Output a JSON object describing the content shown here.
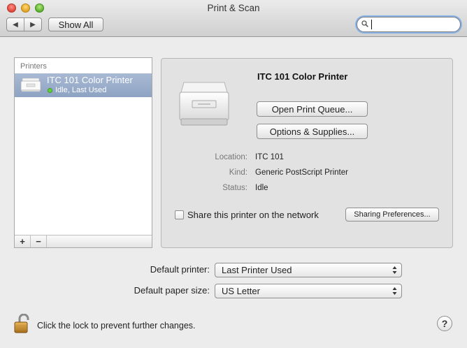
{
  "window": {
    "title": "Print & Scan"
  },
  "toolbar": {
    "back_label": "◀",
    "forward_label": "▶",
    "show_all_label": "Show All",
    "search_placeholder": ""
  },
  "printers": {
    "header": "Printers",
    "items": [
      {
        "name": "ITC 101 Color Printer",
        "status": "Idle, Last Used"
      }
    ],
    "add_label": "+",
    "remove_label": "−"
  },
  "detail": {
    "title": "ITC 101 Color Printer",
    "open_queue_label": "Open Print Queue...",
    "options_label": "Options & Supplies...",
    "location_label": "Location:",
    "location_value": "ITC 101",
    "kind_label": "Kind:",
    "kind_value": "Generic PostScript Printer",
    "status_label": "Status:",
    "status_value": "Idle",
    "share_label": "Share this printer on the network",
    "sharing_prefs_label": "Sharing Preferences..."
  },
  "defaults": {
    "printer_label": "Default printer:",
    "printer_value": "Last Printer Used",
    "paper_label": "Default paper size:",
    "paper_value": "US Letter"
  },
  "footer": {
    "lock_text": "Click the lock to prevent further changes.",
    "help_label": "?"
  },
  "colors": {
    "selection": "#9aadc9",
    "status_dot": "#63d33a",
    "search_focus": "#8ab3e8"
  }
}
